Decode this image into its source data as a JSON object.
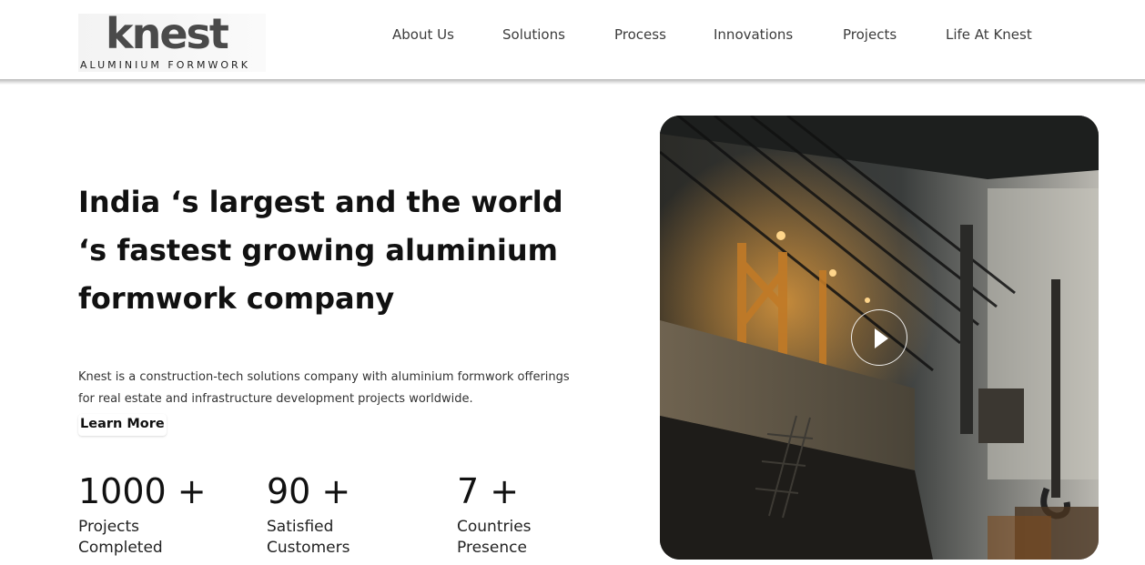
{
  "brand": {
    "name": "knest",
    "tagline": "ALUMINIUM FORMWORK"
  },
  "nav": {
    "items": [
      "About Us",
      "Solutions",
      "Process",
      "Innovations",
      "Projects",
      "Life At Knest"
    ]
  },
  "hero": {
    "headline": "India ‘s largest and the world ‘s fastest growing aluminium formwork company",
    "description": "Knest is a construction-tech solutions company with aluminium formwork offerings for real estate and infrastructure development projects worldwide.",
    "cta_label": "Learn More",
    "media": {
      "type": "video",
      "icon": "play-icon"
    }
  },
  "stats": [
    {
      "value": "1000 +",
      "label": "Projects Completed"
    },
    {
      "value": "90 +",
      "label": "Satisfied Customers"
    },
    {
      "value": "7 +",
      "label": "Countries Presence"
    }
  ],
  "colors": {
    "text": "#111111",
    "nav_text": "#3c3c3c",
    "logo": "#4a4a4a"
  }
}
